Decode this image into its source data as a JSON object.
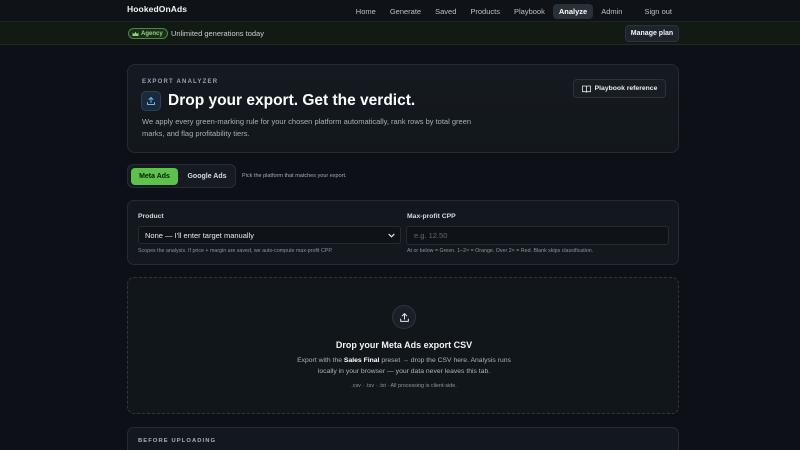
{
  "nav": {
    "brand": "HookedOnAds",
    "links": [
      "Home",
      "Generate",
      "Saved",
      "Products",
      "Playbook",
      "Analyze",
      "Admin"
    ],
    "active": "Analyze",
    "signout": "Sign out"
  },
  "plan_bar": {
    "badge": "Agency",
    "text": "Unlimited generations today",
    "manage_label": "Manage plan"
  },
  "hero": {
    "eyebrow": "EXPORT ANALYZER",
    "title": "Drop your export. Get the verdict.",
    "description": "We apply every green-marking rule for your chosen platform automatically, rank rows by total green marks, and flag profitability tiers.",
    "playbook_label": "Playbook reference"
  },
  "platform": {
    "options": [
      "Meta Ads",
      "Google Ads"
    ],
    "selected": "Meta Ads",
    "hint": "Pick the platform that matches your export."
  },
  "form": {
    "product_label": "Product",
    "product_value": "None — I'll enter target manually",
    "product_hint": "Scopes the analysis. If price + margin are saved, we auto-compute max-profit CPP.",
    "cpp_label": "Max-profit CPP",
    "cpp_placeholder": "e.g. 12.50",
    "cpp_hint": "At or below = Green. 1–2× = Orange. Over 2× = Red. Blank skips classification."
  },
  "dropzone": {
    "title": "Drop your Meta Ads export CSV",
    "desc_pre": "Export with the ",
    "desc_bold": "Sales Final",
    "desc_post": " preset → drop the CSV here. Analysis runs locally in your browser — your data never leaves this tab.",
    "note": ".csv · .tsv · .txt · All processing is client-side."
  },
  "before_uploading": {
    "title": "BEFORE UPLOADING"
  },
  "colors": {
    "accent_green": "#5cc24a",
    "background": "#0d1117"
  }
}
